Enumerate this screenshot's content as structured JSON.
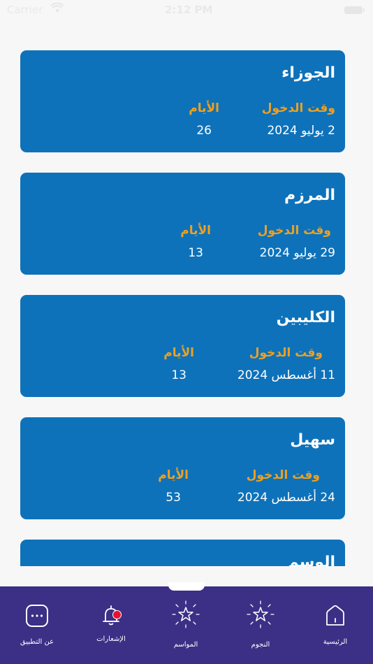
{
  "status_bar": {
    "carrier": "Carrier",
    "time": "2:12 PM"
  },
  "seasons": [
    {
      "name": "الجوزاء",
      "entry_label": "وقت الدخول",
      "days_label": "الأيام",
      "entry_date": "2 يوليو 2024",
      "days": "26"
    },
    {
      "name": "المرزم",
      "entry_label": "وقت الدخول",
      "days_label": "الأيام",
      "entry_date": "29 يوليو 2024",
      "days": "13"
    },
    {
      "name": "الكليبين",
      "entry_label": "وقت الدخول",
      "days_label": "الأيام",
      "entry_date": "11 أغسطس 2024",
      "days": "13"
    },
    {
      "name": "سهيل",
      "entry_label": "وقت الدخول",
      "days_label": "الأيام",
      "entry_date": "24 أغسطس 2024",
      "days": "53"
    },
    {
      "name": "الوسم"
    }
  ],
  "tabs": [
    {
      "label": "عن التطبيق",
      "icon": "more-icon"
    },
    {
      "label": "الإشعارات",
      "icon": "bell-icon"
    },
    {
      "label": "المواسم",
      "icon": "sparkle-star-icon"
    },
    {
      "label": "النجوم",
      "icon": "sparkle-star-icon"
    },
    {
      "label": "الرئيسية",
      "icon": "home-icon"
    }
  ],
  "colors": {
    "card_bg": "#0e72ba",
    "label_orange": "#f0a01e",
    "tab_bar_bg": "#3b2f86",
    "notification_dot": "#e8112d"
  }
}
